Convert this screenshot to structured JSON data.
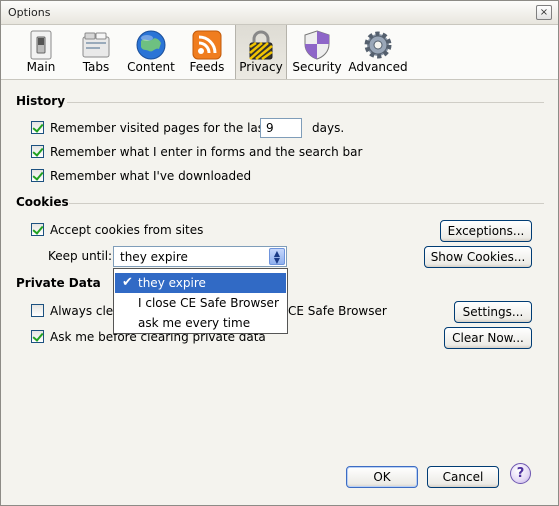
{
  "window": {
    "title": "Options",
    "close_glyph": "×"
  },
  "toolbar": {
    "items": [
      {
        "label": "Main",
        "icon": "switch-icon"
      },
      {
        "label": "Tabs",
        "icon": "tabs-icon"
      },
      {
        "label": "Content",
        "icon": "globe-icon"
      },
      {
        "label": "Feeds",
        "icon": "rss-icon"
      },
      {
        "label": "Privacy",
        "icon": "padlock-icon",
        "selected": true
      },
      {
        "label": "Security",
        "icon": "shield-icon"
      },
      {
        "label": "Advanced",
        "icon": "gear-icon"
      }
    ]
  },
  "history": {
    "title": "History",
    "remember_visited_prefix": "Remember visited pages for the last",
    "remember_visited_days": "9",
    "days_suffix": "days.",
    "remember_forms": "Remember what I enter in forms and the search bar",
    "remember_downloads": "Remember what I've downloaded"
  },
  "cookies": {
    "title": "Cookies",
    "accept": "Accept cookies from sites",
    "exceptions_button": "Exceptions...",
    "keep_until_label": "Keep until:",
    "keep_until_value": "they expire",
    "show_cookies_button": "Show Cookies...",
    "dropdown_options": [
      "they expire",
      "I close CE Safe Browser",
      "ask me every time"
    ]
  },
  "private_data": {
    "title": "Private Data",
    "always_clear_prefix": "Always clea",
    "always_clear_suffix": "CE Safe Browser",
    "settings_button": "Settings...",
    "ask_before_clearing": "Ask me before clearing private data",
    "clear_now_button": "Clear Now..."
  },
  "footer": {
    "ok_button": "OK",
    "cancel_button": "Cancel",
    "help_glyph": "?"
  },
  "colors": {
    "accent": "#316ac5",
    "checkmark": "#21a121"
  }
}
